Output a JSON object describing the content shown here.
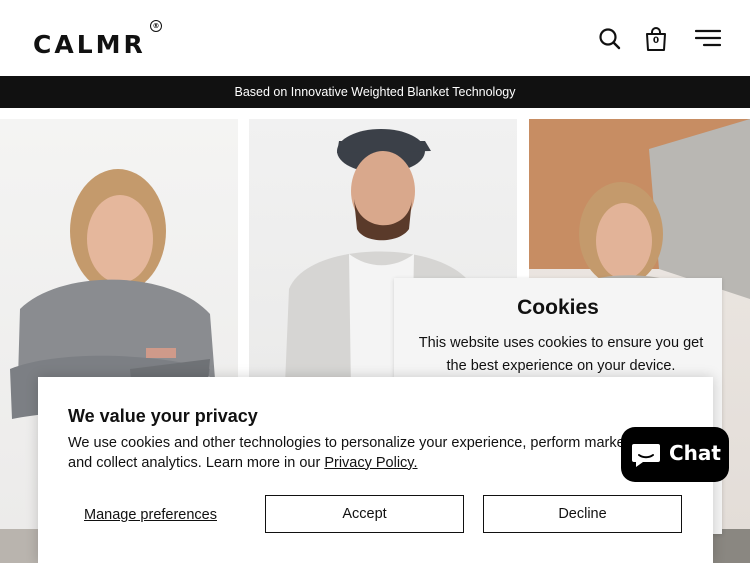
{
  "header": {
    "logo": "CALMR",
    "logo_mark": "®",
    "cart_count": "0",
    "icons": [
      "search-icon",
      "cart-icon",
      "menu-icon"
    ]
  },
  "announcement": {
    "text": "Based on Innovative Weighted Blanket Technology"
  },
  "cookies_popup": {
    "title": "Cookies",
    "text": "This website uses cookies to ensure you get the best experience on your device."
  },
  "privacy_banner": {
    "title": "We value your privacy",
    "text": "We use cookies and other technologies to personalize your experience, perform marketing, and collect analytics. Learn more in our",
    "link": "Privacy Policy.",
    "manage_label": "Manage preferences",
    "accept_label": "Accept",
    "decline_label": "Decline"
  },
  "chat": {
    "label": "Chat",
    "icon": "chat-bubble-icon"
  },
  "colors": {
    "announcement_bg": "#111111",
    "chat_bg": "#000000",
    "popup_bg": "#f5f5f5"
  }
}
